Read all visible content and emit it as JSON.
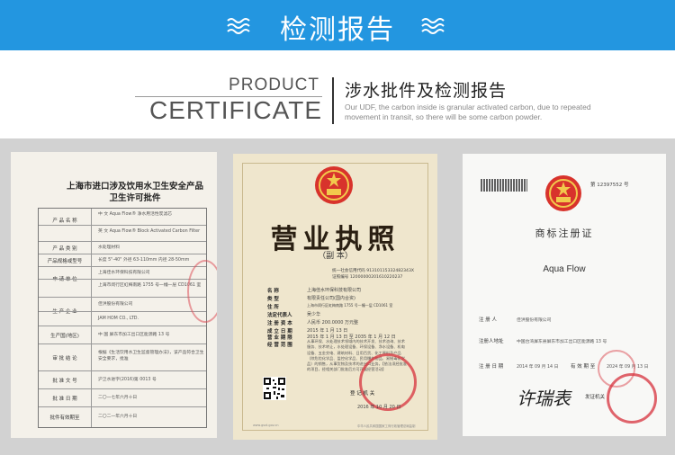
{
  "banner": {
    "title": "检测报告"
  },
  "header": {
    "product": "PRODUCT",
    "certificate": "CERTIFICATE",
    "title_zh": "涉水批件及检测报告",
    "description": "Our UDF, the carbon inside is granular activated carbon, due to repeated movement in transit, so there will be some carbon powder."
  },
  "cert1": {
    "title": "上海市进口涉及饮用水卫生安全产品卫生许可批件",
    "rows": [
      {
        "label": "产 品 名 称",
        "value": "中 文    Aqua Flow® 净水用活性炭滤芯"
      },
      {
        "label": "",
        "value": "英 文    Aqua Flow® Block Activated Carbon Filter"
      },
      {
        "label": "产 品 类 别",
        "value": "水处理材料"
      },
      {
        "label": "产品规格或型号",
        "value": "长度 5\"-40\"   外径 63-110mm   内径 28-50mm"
      },
      {
        "label": "申 请 单 位",
        "value": "上海佳水环保科技有限公司"
      },
      {
        "label": "",
        "value": "上海市闵行区虹梅南路 1755 号一幢一层 CD1061 室"
      },
      {
        "label": "生 产 企 业",
        "value": "佳洪股份有限公司"
      },
      {
        "label": "",
        "value": "JAM HOM CO., LTD."
      },
      {
        "label": "生产国(地区)",
        "value": "中 国    屏东市加工出口区能源路 13 号"
      },
      {
        "label": "审 批 结 论",
        "value": "根据《生活饮用水卫生监督管理办法》，该产品符合卫生安全要求，批准"
      },
      {
        "label": "批 准 文 号",
        "value": "沪卫水进字(2016)第 0013 号"
      },
      {
        "label": "批 准 日 期",
        "value": "二〇一七年六月十日"
      },
      {
        "label": "批件有效期至",
        "value": "二〇二一年六月十日"
      }
    ]
  },
  "cert2": {
    "title": "营业执照",
    "subtitle": "（副  本）",
    "code_lines": [
      "统一社会信用代码 91310115332482343X",
      "证照编号 12000000201610220237"
    ],
    "fields": [
      {
        "label": "名       称",
        "value": "上海佳水环保科技有限公司"
      },
      {
        "label": "类       型",
        "value": "有限责任公司(国内合资)"
      },
      {
        "label": "住       所",
        "value": "上海市闵行区虹梅南路 1755 号一幢一层 CD1061 室"
      },
      {
        "label": "法定代表人",
        "value": "吴少华"
      },
      {
        "label": "注 册 资 本",
        "value": "人民币 200.0000 万元整"
      },
      {
        "label": "成 立 日 期",
        "value": "2015 年 1 月 13 日"
      },
      {
        "label": "营 业 期 限",
        "value": "2015 年 1 月 13 日  至  2035 年 1 月 12 日"
      },
      {
        "label": "经 营 范 围",
        "value": ""
      }
    ],
    "scope": "从事环保、水处理技术领域内的技术开发、技术咨询、技术服务、技术转让，水处理设备、环保设备、净水设备、机电设备、五金交电、建筑材料、日用百货、化工原料及产品（除危险化学品、监控化学品、民用爆炸物品、易制毒化学品）的销售，从事货物及技术的进出口业务。【依法须经批准的项目，经相关部门批准后方可开展经营活动】",
    "registration_label": "登 记 机 关",
    "date": "2016 年 10 月 20 日",
    "url": "www.gsxt.gov.cn",
    "footer": "中华人民共和国国家工商行政管理总局监制"
  },
  "cert3": {
    "number": "第 12397552 号",
    "title": "商标注册证",
    "mark": "Aqua Flow",
    "rows": [
      {
        "label": "注 册 人",
        "value": "佳洪股份有限公司"
      },
      {
        "label": "注册人地址",
        "value": "中国台湾屏东县屏东市加工出口区能源路 13 号"
      },
      {
        "label": "注 册 日 期",
        "value": "2014 年 09 月 14 日"
      },
      {
        "label": "有 效 期 至",
        "value": "2024 年 09 月 13 日"
      }
    ],
    "signature": "许瑞表",
    "signature_label": "发证机关"
  }
}
